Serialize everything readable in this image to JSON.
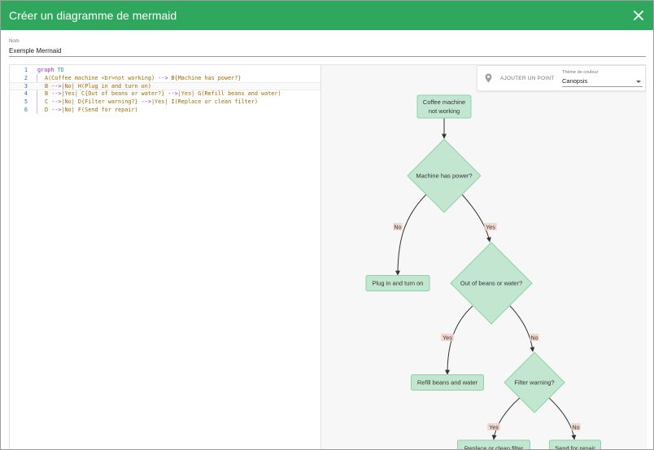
{
  "dialog": {
    "title": "Créer un diagramme de mermaid",
    "close_icon": "close-icon"
  },
  "name_field": {
    "label": "Nom",
    "value": "Exemple Mermaid"
  },
  "editor": {
    "lines": [
      {
        "number": "1",
        "parts": [
          {
            "text": "graph ",
            "cls": "kw"
          },
          {
            "text": "TD",
            "cls": "ty"
          }
        ]
      },
      {
        "number": "2",
        "parts": [
          {
            "text": "A(Coffee machine <br>not working) ",
            "cls": ""
          },
          {
            "text": "-->",
            "cls": "kw"
          },
          {
            "text": " B{Machine has power?}",
            "cls": ""
          }
        ]
      },
      {
        "number": "3",
        "parts": [
          {
            "text": "B ",
            "cls": ""
          },
          {
            "text": "-->",
            "cls": "kw"
          },
          {
            "text": "|No| H(Plug in and turn on)",
            "cls": ""
          }
        ]
      },
      {
        "number": "4",
        "parts": [
          {
            "text": "B ",
            "cls": ""
          },
          {
            "text": "-->",
            "cls": "kw"
          },
          {
            "text": "|Yes| C{Out of beans or water?} ",
            "cls": ""
          },
          {
            "text": "-->",
            "cls": "kw"
          },
          {
            "text": "|Yes| G(Refill beans and water)",
            "cls": ""
          }
        ]
      },
      {
        "number": "5",
        "parts": [
          {
            "text": "C ",
            "cls": ""
          },
          {
            "text": "-->",
            "cls": "kw"
          },
          {
            "text": "|No| D{Filter warning?} ",
            "cls": ""
          },
          {
            "text": "-->",
            "cls": "kw"
          },
          {
            "text": "|Yes| I(Replace or clean filter)",
            "cls": ""
          }
        ]
      },
      {
        "number": "6",
        "parts": [
          {
            "text": "D ",
            "cls": ""
          },
          {
            "text": "-->",
            "cls": "kw"
          },
          {
            "text": "|No| F(Send for repair)",
            "cls": ""
          }
        ]
      }
    ]
  },
  "preview_toolbar": {
    "pin_icon": "map-pin-icon",
    "add_point_label": "AJOUTER UN POINT",
    "theme_label": "Thème de couleur",
    "theme_value": "Canopsis"
  },
  "diagram": {
    "colors": {
      "node_fill": "#c2e6cf",
      "node_stroke": "#8fd3a4",
      "edge": "#333333",
      "label_bg": "#f0d2c4"
    },
    "nodes": [
      {
        "id": "A",
        "shape": "rect",
        "lines": [
          "Coffee machine",
          "not working"
        ]
      },
      {
        "id": "B",
        "shape": "diamond",
        "lines": [
          "Machine has power?"
        ]
      },
      {
        "id": "H",
        "shape": "rect",
        "lines": [
          "Plug in and turn on"
        ]
      },
      {
        "id": "C",
        "shape": "diamond",
        "lines": [
          "Out of beans or water?"
        ]
      },
      {
        "id": "G",
        "shape": "rect",
        "lines": [
          "Refill beans and water"
        ]
      },
      {
        "id": "D",
        "shape": "diamond",
        "lines": [
          "Filter warning?"
        ]
      },
      {
        "id": "I",
        "shape": "rect",
        "lines": [
          "Replace or clean filter"
        ]
      },
      {
        "id": "F",
        "shape": "rect",
        "lines": [
          "Send for repair"
        ]
      }
    ],
    "edges": [
      {
        "from": "A",
        "to": "B",
        "label": ""
      },
      {
        "from": "B",
        "to": "H",
        "label": "No"
      },
      {
        "from": "B",
        "to": "C",
        "label": "Yes"
      },
      {
        "from": "C",
        "to": "G",
        "label": "Yes"
      },
      {
        "from": "C",
        "to": "D",
        "label": "No"
      },
      {
        "from": "D",
        "to": "I",
        "label": "Yes"
      },
      {
        "from": "D",
        "to": "F",
        "label": "No"
      }
    ]
  }
}
